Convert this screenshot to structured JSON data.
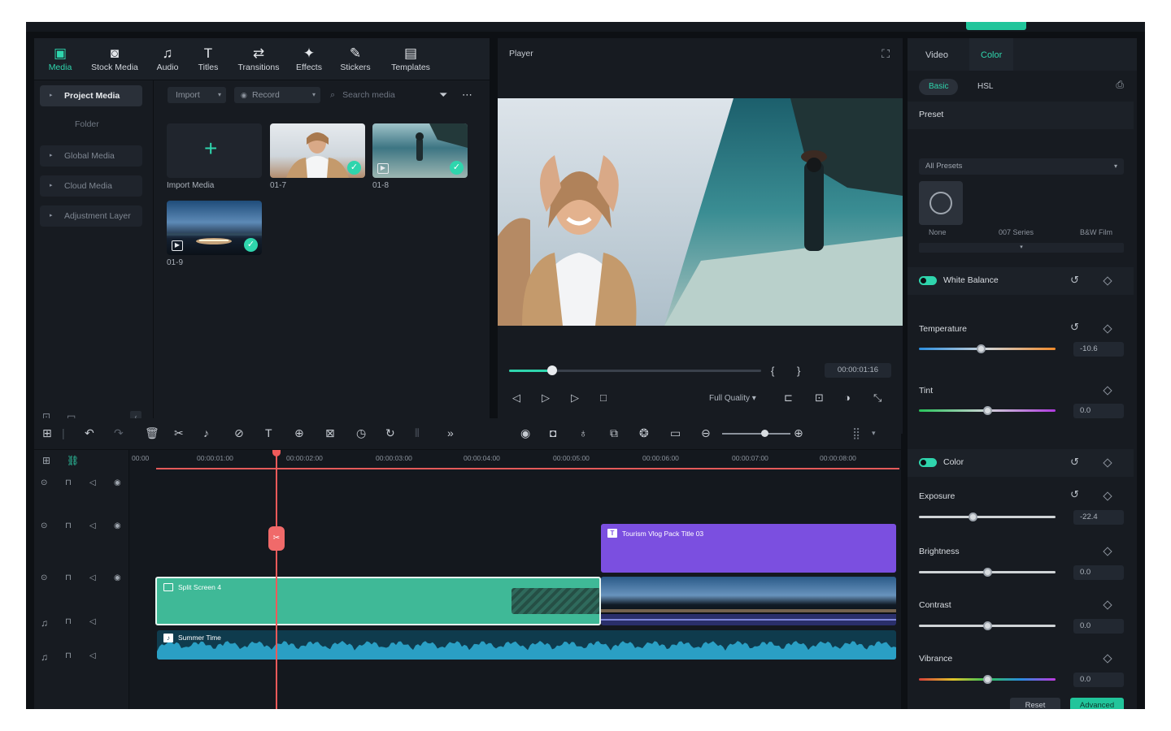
{
  "media_tabs": [
    {
      "label": "Media",
      "icon": "media-icon"
    },
    {
      "label": "Stock Media",
      "icon": "stock-media-icon"
    },
    {
      "label": "Audio",
      "icon": "music-note-icon"
    },
    {
      "label": "Titles",
      "icon": "text-icon"
    },
    {
      "label": "Transitions",
      "icon": "transitions-icon"
    },
    {
      "label": "Effects",
      "icon": "effects-icon"
    },
    {
      "label": "Stickers",
      "icon": "stickers-icon"
    },
    {
      "label": "Templates",
      "icon": "templates-icon"
    }
  ],
  "sidebar": {
    "project_media": "Project Media",
    "folder": "Folder",
    "global_media": "Global Media",
    "cloud_media": "Cloud Media",
    "adjustment_layer": "Adjustment Layer"
  },
  "toolbar": {
    "import": "Import",
    "record": "Record",
    "search_placeholder": "Search media"
  },
  "media_items": [
    {
      "label": "Import Media"
    },
    {
      "label": "01-7"
    },
    {
      "label": "01-8"
    },
    {
      "label": "01-9"
    }
  ],
  "player": {
    "title": "Player",
    "timecode": "00:00:01:16",
    "quality": "Full Quality",
    "progress": 0.17
  },
  "right_panel": {
    "tabs": [
      "Video",
      "Color"
    ],
    "subtabs": [
      "Basic",
      "HSL"
    ],
    "preset_section": "Preset",
    "preset_dropdown": "All Presets",
    "presets": [
      "None",
      "007 Series",
      "B&W Film"
    ],
    "white_balance": "White Balance",
    "temperature": {
      "label": "Temperature",
      "value": "-10.6",
      "level": 0.45
    },
    "tint": {
      "label": "Tint",
      "value": "0.0",
      "level": 0.5
    },
    "color": "Color",
    "exposure": {
      "label": "Exposure",
      "value": "-22.4",
      "level": 0.39
    },
    "brightness": {
      "label": "Brightness",
      "value": "0.0",
      "level": 0.5
    },
    "contrast": {
      "label": "Contrast",
      "value": "0.0",
      "level": 0.5
    },
    "vibrance": {
      "label": "Vibrance",
      "value": "0.0",
      "level": 0.5
    },
    "reset": "Reset",
    "advanced": "Advanced"
  },
  "timeline": {
    "ruler": [
      "00:00",
      "00:00:01:00",
      "00:00:02:00",
      "00:00:03:00",
      "00:00:04:00",
      "00:00:05:00",
      "00:00:06:00",
      "00:00:07:00",
      "00:00:08:00"
    ],
    "clips": {
      "title_clip": "Tourism Vlog Pack Title 03",
      "split_screen": "Split Screen 4",
      "audio": "Summer Time"
    }
  },
  "colors": {
    "accent": "#2fd5ad",
    "title_clip": "#7b4fe0",
    "split_clip": "#3fb997",
    "playhead": "#f05a5a"
  }
}
